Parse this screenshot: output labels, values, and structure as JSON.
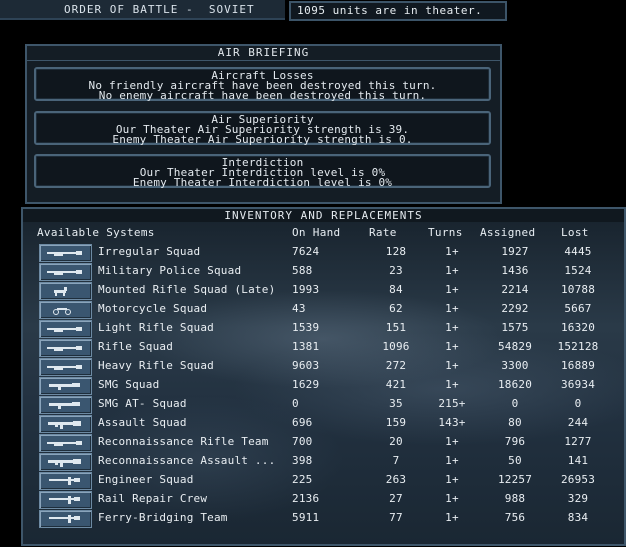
{
  "header": {
    "title": "ORDER OF BATTLE -  SOVIET",
    "units_text": "1095 units are in theater."
  },
  "air_briefing": {
    "title": "AIR BRIEFING",
    "aircraft_losses": {
      "title": "Aircraft Losses",
      "line1": "No friendly aircraft have been destroyed this turn.",
      "line2": "No enemy aircraft have been destroyed this turn."
    },
    "air_superiority": {
      "title": "Air Superiority",
      "line1": "Our Theater Air Superiority strength is 39.",
      "line2": "Enemy Theater Air Superiority strength is 0."
    },
    "interdiction": {
      "title": "Interdiction",
      "line1": "Our Theater Interdiction level is 0%",
      "line2": "Enemy Theater Interdiction level is 0%"
    }
  },
  "inventory": {
    "title": "INVENTORY AND REPLACEMENTS",
    "columns": {
      "systems": "Available Systems",
      "on_hand": "On Hand",
      "rate": "Rate",
      "turns": "Turns",
      "assigned": "Assigned",
      "lost": "Lost"
    },
    "rows": [
      {
        "name": "Irregular Squad",
        "on_hand": "7624",
        "rate": "128",
        "turns": "1+",
        "assigned": "1927",
        "lost": "4445",
        "icon": "rifle-icon"
      },
      {
        "name": "Military Police Squad",
        "on_hand": "588",
        "rate": "23",
        "turns": "1+",
        "assigned": "1436",
        "lost": "1524",
        "icon": "rifle-icon"
      },
      {
        "name": "Mounted Rifle Squad (Late)",
        "on_hand": "1993",
        "rate": "84",
        "turns": "1+",
        "assigned": "2214",
        "lost": "10788",
        "icon": "horse-icon"
      },
      {
        "name": "Motorcycle Squad",
        "on_hand": "43",
        "rate": "62",
        "turns": "1+",
        "assigned": "2292",
        "lost": "5667",
        "icon": "motorcycle-icon"
      },
      {
        "name": "Light Rifle Squad",
        "on_hand": "1539",
        "rate": "151",
        "turns": "1+",
        "assigned": "1575",
        "lost": "16320",
        "icon": "rifle-icon"
      },
      {
        "name": "Rifle Squad",
        "on_hand": "1381",
        "rate": "1096",
        "turns": "1+",
        "assigned": "54829",
        "lost": "152128",
        "icon": "rifle-icon"
      },
      {
        "name": "Heavy Rifle Squad",
        "on_hand": "9603",
        "rate": "272",
        "turns": "1+",
        "assigned": "3300",
        "lost": "16889",
        "icon": "rifle-icon"
      },
      {
        "name": "SMG Squad",
        "on_hand": "1629",
        "rate": "421",
        "turns": "1+",
        "assigned": "18620",
        "lost": "36934",
        "icon": "smg-icon"
      },
      {
        "name": "SMG AT- Squad",
        "on_hand": "0",
        "rate": "35",
        "turns": "215+",
        "assigned": "0",
        "lost": "0",
        "icon": "smg-icon"
      },
      {
        "name": "Assault Squad",
        "on_hand": "696",
        "rate": "159",
        "turns": "143+",
        "assigned": "80",
        "lost": "244",
        "icon": "assault-rifle-icon"
      },
      {
        "name": "Reconnaissance Rifle Team",
        "on_hand": "700",
        "rate": "20",
        "turns": "1+",
        "assigned": "796",
        "lost": "1277",
        "icon": "rifle-icon"
      },
      {
        "name": "Reconnaissance Assault ...",
        "on_hand": "398",
        "rate": "7",
        "turns": "1+",
        "assigned": "50",
        "lost": "141",
        "icon": "assault-rifle-icon"
      },
      {
        "name": "Engineer Squad",
        "on_hand": "225",
        "rate": "263",
        "turns": "1+",
        "assigned": "12257",
        "lost": "26953",
        "icon": "engineer-icon"
      },
      {
        "name": "Rail Repair Crew",
        "on_hand": "2136",
        "rate": "27",
        "turns": "1+",
        "assigned": "988",
        "lost": "329",
        "icon": "engineer-icon"
      },
      {
        "name": "Ferry-Bridging Team",
        "on_hand": "5911",
        "rate": "77",
        "turns": "1+",
        "assigned": "756",
        "lost": "834",
        "icon": "engineer-icon"
      }
    ]
  },
  "colors": {
    "panel_border": "#3e566a",
    "button": "#3a5670",
    "text": "#e9eef2"
  }
}
